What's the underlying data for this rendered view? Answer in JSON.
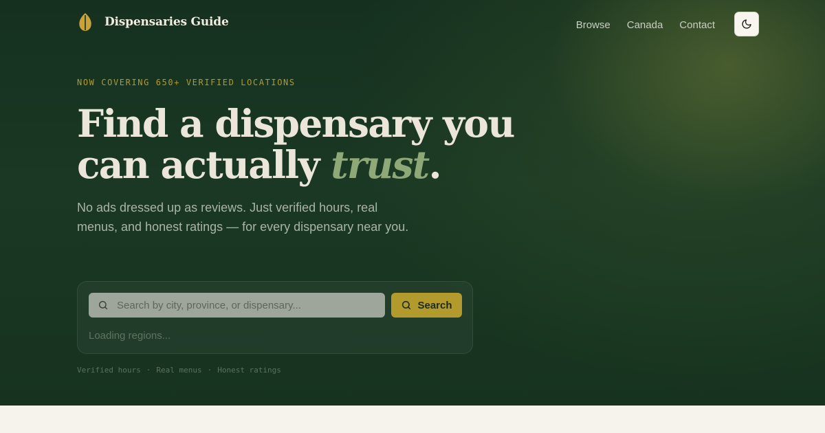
{
  "nav": {
    "brand_name": "Dispensaries Guide",
    "links": [
      {
        "label": "Browse"
      },
      {
        "label": "Canada"
      },
      {
        "label": "Contact"
      }
    ],
    "theme_toggle_icon": "moon-icon"
  },
  "hero": {
    "eyebrow": "NOW COVERING 650+ VERIFIED LOCATIONS",
    "headline_line1": "Find a dispensary you",
    "headline_line2_prefix": "can actually ",
    "headline_accent": "trust",
    "headline_suffix": ".",
    "subhead": "No ads dressed up as reviews. Just verified hours, real menus, and honest ratings — for every dispensary near you."
  },
  "search": {
    "placeholder": "Search by city, province, or dispensary...",
    "value": "",
    "button_label": "Search",
    "status": "Loading regions..."
  },
  "features": [
    "Verified hours",
    "·",
    "Real menus",
    "·",
    "Honest ratings"
  ],
  "colors": {
    "hero_background": "#17331f",
    "accent_gold": "#b29a2c",
    "accent_sage": "#8fa877",
    "page_background": "#f6f3ec"
  }
}
